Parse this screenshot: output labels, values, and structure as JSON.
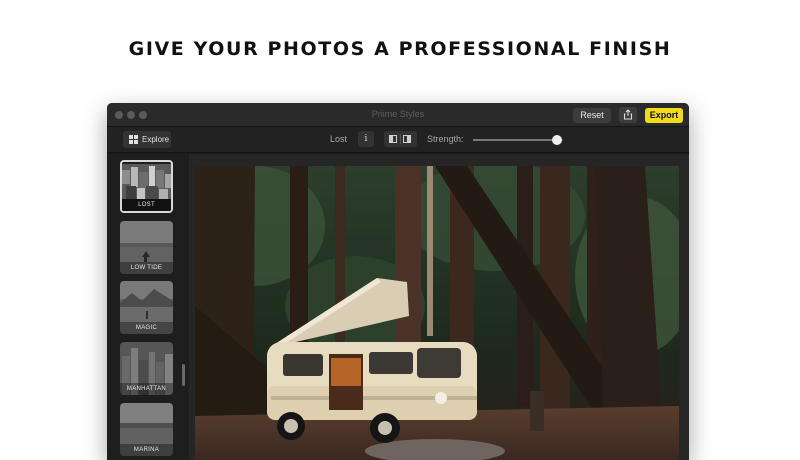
{
  "headline": "GIVE YOUR PHOTOS A PROFESSIONAL FINISH",
  "window": {
    "title": "Priime Styles",
    "reset_label": "Reset",
    "share_icon": "share-icon",
    "export_label": "Export"
  },
  "toolbar": {
    "explore_label": "Explore",
    "explore_icon": "grid-icon",
    "style_name": "Lost",
    "info_label": "i",
    "compare_icon": "split-view-icon",
    "strength_label": "Strength:",
    "strength_value": 0.93
  },
  "sidebar": {
    "styles": [
      {
        "label": "LOST",
        "selected": true
      },
      {
        "label": "LOW TIDE",
        "selected": false
      },
      {
        "label": "MAGIC",
        "selected": false
      },
      {
        "label": "MANHATTAN",
        "selected": false
      },
      {
        "label": "MARINA",
        "selected": false
      }
    ]
  },
  "colors": {
    "accent": "#f2da1c",
    "window_bg": "#1b1b1b",
    "titlebar_bg": "#2a2a2a"
  }
}
